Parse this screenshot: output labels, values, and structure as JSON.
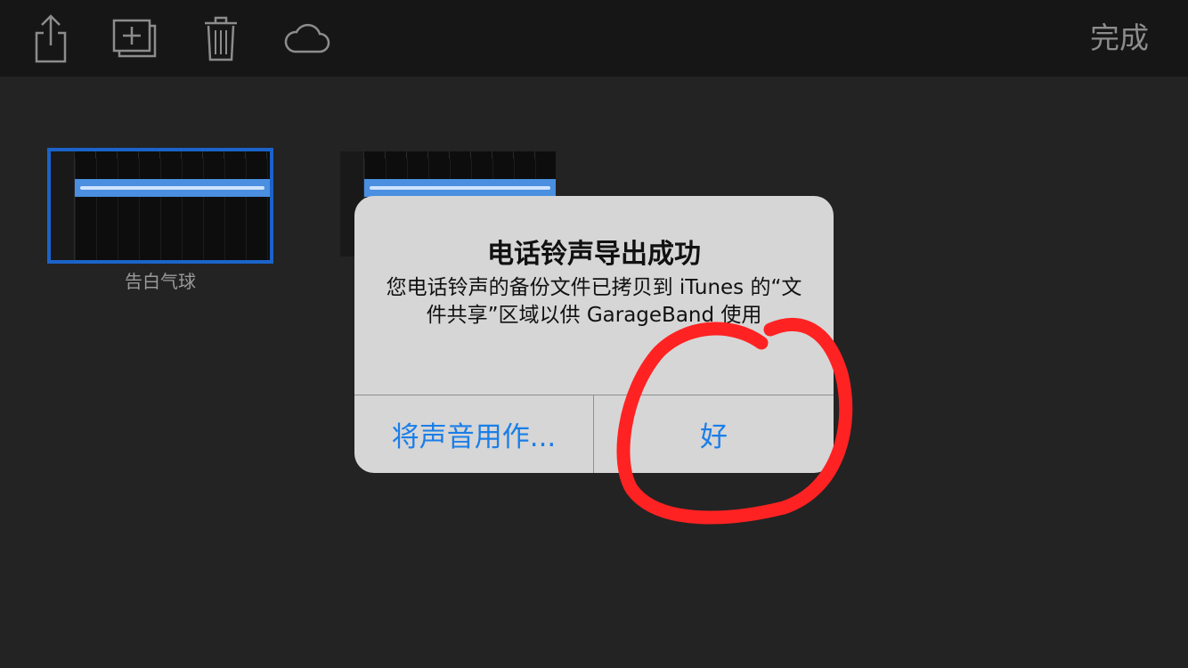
{
  "toolbar": {
    "icons": [
      "share-icon",
      "add-icon",
      "trash-icon",
      "cloud-icon"
    ],
    "done_label": "完成"
  },
  "songs": [
    {
      "title": "告白气球",
      "selected": true
    },
    {
      "title": "",
      "selected": false
    }
  ],
  "alert": {
    "title": "电话铃声导出成功",
    "message": "您电话铃声的备份文件已拷贝到 iTunes 的“文件共享”区域以供 GarageBand 使用",
    "button_left": "将声音用作...",
    "button_right": "好"
  },
  "colors": {
    "accent": "#1a7ee8",
    "selection": "#1b63c9",
    "annotation": "#ff2222"
  }
}
